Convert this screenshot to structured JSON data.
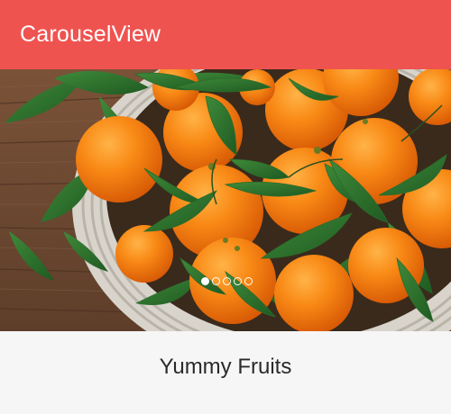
{
  "toolbar": {
    "title": "CarouselView",
    "background_color": "#ef5350"
  },
  "carousel": {
    "image": "photo of mandarin oranges with leaves in a white wicker basket on a wooden table",
    "item_count": 5,
    "active_index": 0,
    "caption": "Yummy Fruits"
  }
}
